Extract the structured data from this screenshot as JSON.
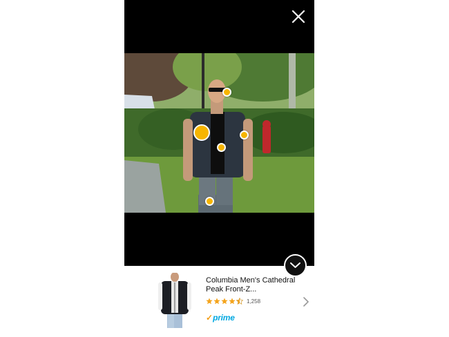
{
  "viewer": {
    "close_icon": "close-icon",
    "hotspots": [
      {
        "name": "hotspot-sunglasses",
        "size": "small"
      },
      {
        "name": "hotspot-vest",
        "size": "large"
      },
      {
        "name": "hotspot-shirt",
        "size": "small"
      },
      {
        "name": "hotspot-pocket",
        "size": "small"
      },
      {
        "name": "hotspot-pants",
        "size": "small"
      }
    ],
    "collapse_icon": "chevron-down-icon",
    "colors": {
      "hotspot": "#f7b500",
      "backdrop": "#000000"
    }
  },
  "product": {
    "title": "Columbia Men's Cathedral Peak Front-Z...",
    "rating": 4.5,
    "review_count": "1,258",
    "prime_label": "prime",
    "prime_check": "✓",
    "colors": {
      "star": "#f4a41c",
      "prime": "#00a8e1"
    },
    "chevron_icon": "chevron-right-icon"
  }
}
